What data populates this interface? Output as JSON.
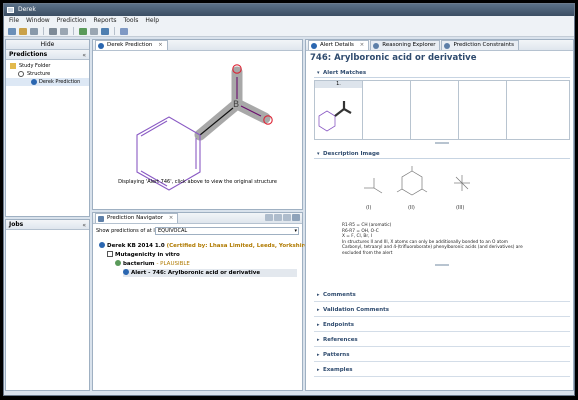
{
  "window": {
    "title": "Derek"
  },
  "menu": [
    "File",
    "Window",
    "Prediction",
    "Reports",
    "Tools",
    "Help"
  ],
  "left": {
    "hide_label": "Hide",
    "predictions_title": "Predictions",
    "tree": [
      "Study Folder",
      "Structure",
      "Derek Prediction"
    ],
    "jobs_title": "Jobs"
  },
  "middle": {
    "tab_label": "Derek Prediction",
    "structure_caption": "Displaying 'Alert 746', click above to view the original structure",
    "navigator_tab": "Prediction Navigator",
    "show_label": "Show predictions of at least:",
    "show_value": "EQUIVOCAL",
    "nav_items": [
      {
        "text": "Derek KB 2014 1.0",
        "extra": "(Certified by: Lhasa Limited, Leeds, Yorkshire, UK)"
      },
      {
        "text": "Mutagenicity in vitro",
        "extra": ""
      },
      {
        "text": "bacterium",
        "extra": "- PLAUSIBLE"
      },
      {
        "text": "Alert - 746: Arylboronic acid or derivative",
        "extra": ""
      }
    ]
  },
  "right": {
    "tabs": [
      "Alert Details",
      "Reasoning Explorer",
      "Prediction Constraints"
    ],
    "heading": "746: Arylboronic acid or derivative",
    "alert_matches_title": "Alert Matches",
    "match_index": "1.",
    "description_image_title": "Description Image",
    "description_lines": [
      "R1-R5 = CH (aromatic)",
      "R6-R7 = OH, O-C",
      "X = F, Cl, Br, I",
      "In structures II and III, X atoms can only be additionally bonded to an O atom",
      "Carbonyl, tetraaryl and 4-(trifluoroborate) phenylboronic acids (and derivatives) are",
      "excluded from the alert"
    ],
    "diagram_labels": [
      "(I)",
      "(II)",
      "(III)"
    ],
    "sections": [
      "Comments",
      "Validation Comments",
      "Endpoints",
      "References",
      "Patterns",
      "Examples"
    ]
  },
  "colors": {
    "accent": "#2a66b0",
    "plausible": "#b07a00",
    "certified": "#b07a00",
    "bond_highlight": "#999999"
  }
}
